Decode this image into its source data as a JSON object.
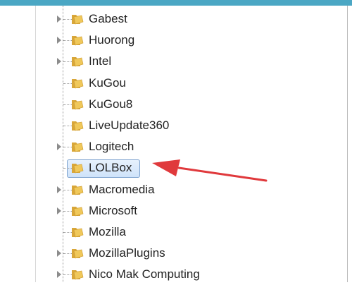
{
  "tree": {
    "items": [
      {
        "label": "Gabest",
        "expandable": true,
        "selected": false
      },
      {
        "label": "Huorong",
        "expandable": true,
        "selected": false
      },
      {
        "label": "Intel",
        "expandable": true,
        "selected": false
      },
      {
        "label": "KuGou",
        "expandable": false,
        "selected": false
      },
      {
        "label": "KuGou8",
        "expandable": false,
        "selected": false
      },
      {
        "label": "LiveUpdate360",
        "expandable": false,
        "selected": false
      },
      {
        "label": "Logitech",
        "expandable": true,
        "selected": false
      },
      {
        "label": "LOLBox",
        "expandable": false,
        "selected": true
      },
      {
        "label": "Macromedia",
        "expandable": true,
        "selected": false
      },
      {
        "label": "Microsoft",
        "expandable": true,
        "selected": false
      },
      {
        "label": "Mozilla",
        "expandable": false,
        "selected": false
      },
      {
        "label": "MozillaPlugins",
        "expandable": true,
        "selected": false
      },
      {
        "label": "Nico Mak Computing",
        "expandable": true,
        "selected": false
      }
    ]
  },
  "colors": {
    "topbar": "#4ba7c4",
    "selection_border": "#7da2ce",
    "arrow": "#e0393c",
    "folder": "#f0c85a"
  },
  "icons": {
    "folder": "folder-icon",
    "expander": "triangle-right-icon",
    "annotation": "red-arrow-icon"
  }
}
